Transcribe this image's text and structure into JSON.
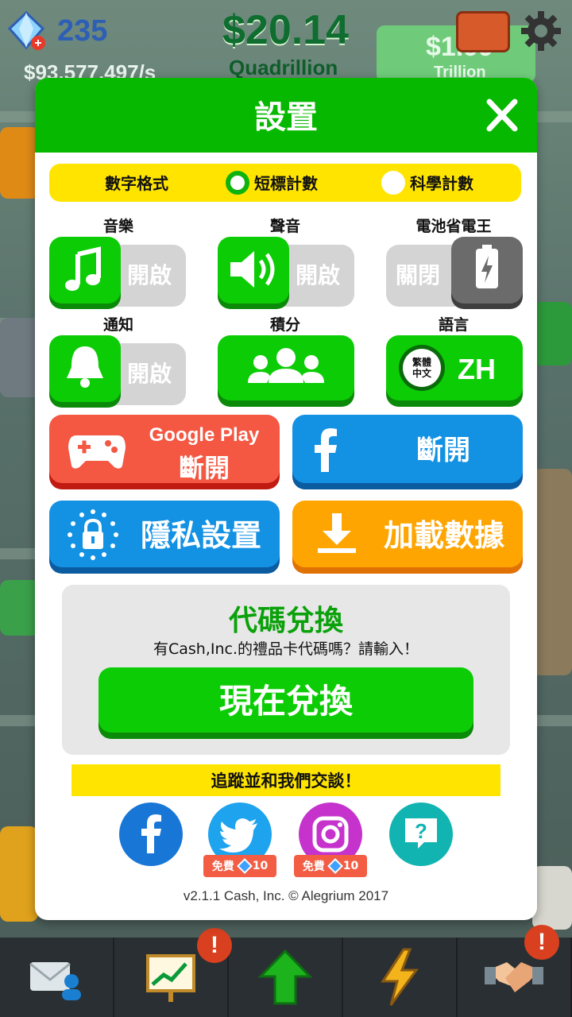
{
  "hud": {
    "gems": "235",
    "cash": "$20.14",
    "cash_unit": "Quadrillion",
    "rate": "$93,577,497/s",
    "right_value": "$1.99",
    "right_unit": "Trillion"
  },
  "modal": {
    "title": "設置",
    "number_format": {
      "label": "數字格式",
      "option_short": "短標計數",
      "option_scientific": "科學計數",
      "selected": "短標計數"
    },
    "settings": {
      "music": {
        "label": "音樂",
        "state": "開啟"
      },
      "sound": {
        "label": "聲音",
        "state": "開啟"
      },
      "battery_saver": {
        "label": "電池省電王",
        "state": "關閉"
      },
      "notifications": {
        "label": "通知",
        "state": "開啟"
      },
      "leaderboard": {
        "label": "積分"
      },
      "language": {
        "label": "語言",
        "badge": "繁體\n中文",
        "code": "ZH"
      }
    },
    "google_play": {
      "title": "Google Play",
      "action": "斷開"
    },
    "facebook": {
      "action": "斷開"
    },
    "privacy": {
      "label": "隱私設置"
    },
    "load_data": {
      "label": "加載數據"
    },
    "redeem": {
      "title": "代碼兌換",
      "subtitle": "有Cash,Inc.的禮品卡代碼嗎？請輸入！",
      "button": "現在兌換"
    },
    "follow": {
      "banner": "追蹤並和我們交談！"
    },
    "social_rewards": {
      "twitter": {
        "free": "免費",
        "amount": "10"
      },
      "instagram": {
        "free": "免費",
        "amount": "10"
      }
    },
    "version": "v2.1.1 Cash, Inc. © Alegrium 2017"
  },
  "colors": {
    "green": "#0ccc06",
    "header_green": "#06b800",
    "red": "#f45742",
    "blue": "#1391e3",
    "orange": "#ffa502",
    "yellow": "#ffe400"
  }
}
